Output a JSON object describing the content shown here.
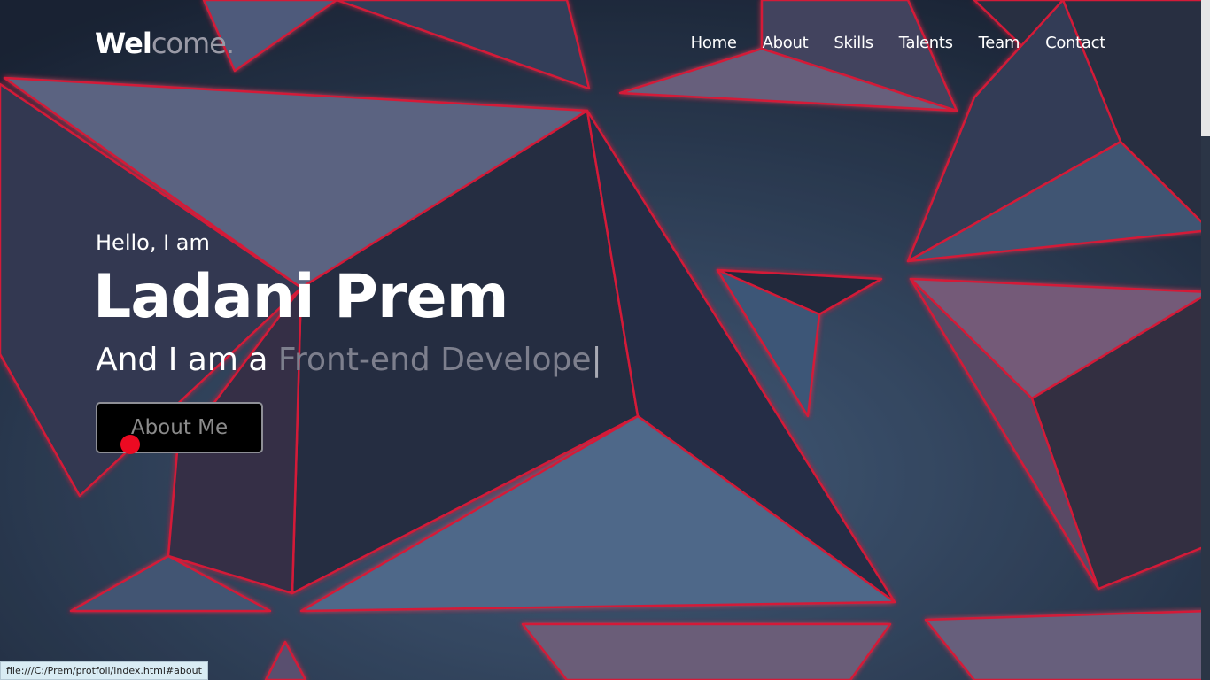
{
  "logo": {
    "part1": "Wel",
    "part2": "come."
  },
  "nav": {
    "items": [
      {
        "label": "Home"
      },
      {
        "label": "About"
      },
      {
        "label": "Skills"
      },
      {
        "label": "Talents"
      },
      {
        "label": "Team"
      },
      {
        "label": "Contact"
      }
    ]
  },
  "hero": {
    "greeting": "Hello, I am",
    "name": "Ladani Prem",
    "role_prefix": "And I am a",
    "role_typed": "Front-end Develope",
    "typing_cursor": "|",
    "button_label": "About Me"
  },
  "status_bar": {
    "url": "file:///C:/Prem/protfoli/index.html#about"
  },
  "colors": {
    "accent_red": "#ec0a22",
    "text_white": "#ffffff",
    "muted_gray": "#7d7f8d",
    "background_navy": "#1e2a3e"
  }
}
